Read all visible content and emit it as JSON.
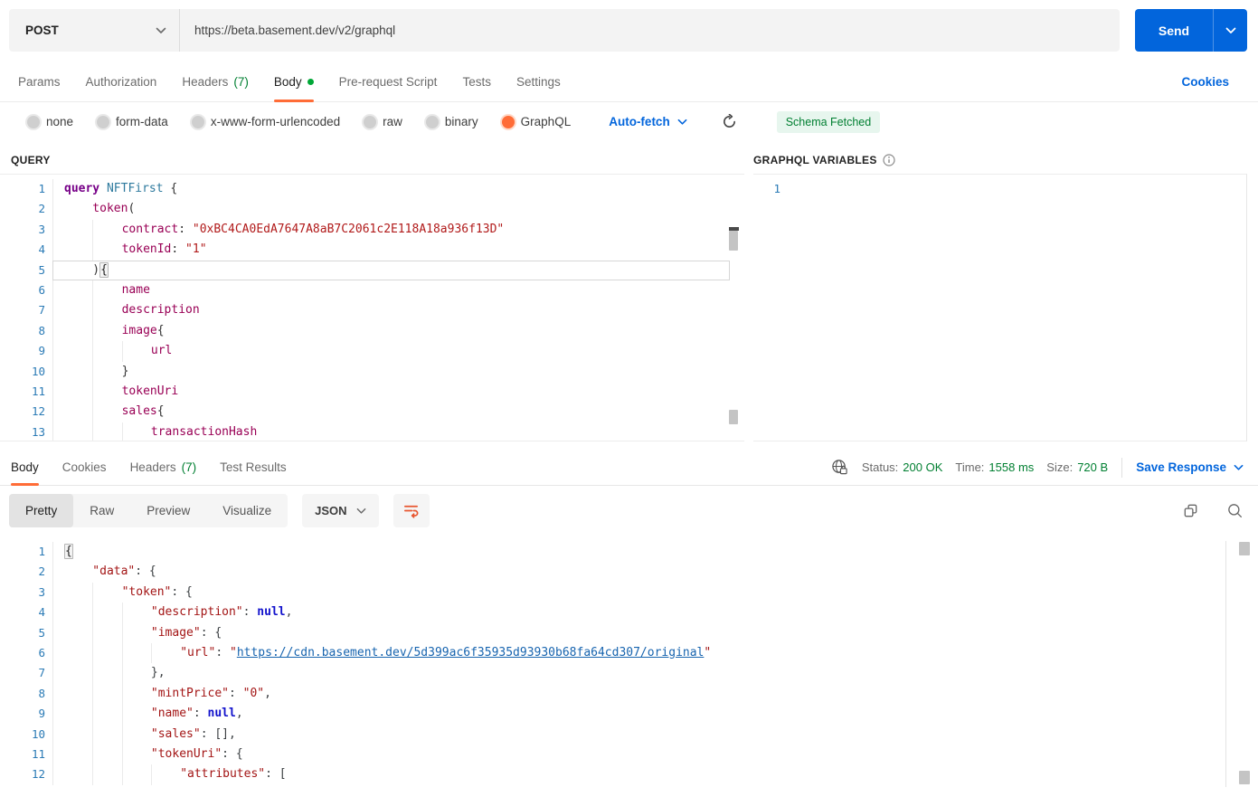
{
  "request": {
    "method": "POST",
    "url": "https://beta.basement.dev/v2/graphql",
    "send_label": "Send"
  },
  "request_tabs": {
    "items": [
      {
        "label": "Params"
      },
      {
        "label": "Authorization"
      },
      {
        "label": "Headers",
        "count": "(7)"
      },
      {
        "label": "Body",
        "dot": true,
        "active": true
      },
      {
        "label": "Pre-request Script"
      },
      {
        "label": "Tests"
      },
      {
        "label": "Settings"
      }
    ],
    "cookies_link": "Cookies"
  },
  "body_modes": {
    "options": [
      {
        "label": "none"
      },
      {
        "label": "form-data"
      },
      {
        "label": "x-www-form-urlencoded"
      },
      {
        "label": "raw"
      },
      {
        "label": "binary"
      },
      {
        "label": "GraphQL",
        "selected": true
      }
    ],
    "autofetch_label": "Auto-fetch",
    "schema_badge": "Schema Fetched"
  },
  "query_panel": {
    "title": "QUERY",
    "lines": [
      {
        "n": 1,
        "i": 0,
        "t": [
          [
            "kw",
            "query"
          ],
          [
            "pl",
            " "
          ],
          [
            "op",
            "NFTFirst"
          ],
          [
            "pl",
            " {"
          ]
        ]
      },
      {
        "n": 2,
        "i": 1,
        "t": [
          [
            "prop",
            "token"
          ],
          [
            "pl",
            "("
          ]
        ]
      },
      {
        "n": 3,
        "i": 2,
        "t": [
          [
            "prop",
            "contract"
          ],
          [
            "pl",
            ": "
          ],
          [
            "str",
            "\"0xBC4CA0EdA7647A8aB7C2061c2E118A18a936f13D\""
          ]
        ]
      },
      {
        "n": 4,
        "i": 2,
        "t": [
          [
            "prop",
            "tokenId"
          ],
          [
            "pl",
            ": "
          ],
          [
            "str",
            "\"1\""
          ]
        ]
      },
      {
        "n": 5,
        "i": 1,
        "a": true,
        "t": [
          [
            "pl",
            ")"
          ],
          [
            "brk",
            "{"
          ]
        ]
      },
      {
        "n": 6,
        "i": 2,
        "t": [
          [
            "prop",
            "name"
          ]
        ]
      },
      {
        "n": 7,
        "i": 2,
        "t": [
          [
            "prop",
            "description"
          ]
        ]
      },
      {
        "n": 8,
        "i": 2,
        "t": [
          [
            "prop",
            "image"
          ],
          [
            "pl",
            "{"
          ]
        ]
      },
      {
        "n": 9,
        "i": 3,
        "t": [
          [
            "prop",
            "url"
          ]
        ]
      },
      {
        "n": 10,
        "i": 2,
        "t": [
          [
            "pl",
            "}"
          ]
        ]
      },
      {
        "n": 11,
        "i": 2,
        "t": [
          [
            "prop",
            "tokenUri"
          ]
        ]
      },
      {
        "n": 12,
        "i": 2,
        "t": [
          [
            "prop",
            "sales"
          ],
          [
            "pl",
            "{"
          ]
        ]
      },
      {
        "n": 13,
        "i": 3,
        "t": [
          [
            "prop",
            "transactionHash"
          ]
        ]
      }
    ]
  },
  "variables_panel": {
    "title": "GRAPHQL VARIABLES",
    "lines": [
      {
        "n": 1,
        "i": 0,
        "t": []
      }
    ]
  },
  "response": {
    "tabs": [
      {
        "label": "Body",
        "active": true
      },
      {
        "label": "Cookies"
      },
      {
        "label": "Headers",
        "count": "(7)"
      },
      {
        "label": "Test Results"
      }
    ],
    "status_items": [
      {
        "label": "Status:",
        "value": "200 OK"
      },
      {
        "label": "Time:",
        "value": "1558 ms"
      },
      {
        "label": "Size:",
        "value": "720 B"
      }
    ],
    "save_label": "Save Response",
    "view_tabs": [
      {
        "label": "Pretty",
        "active": true
      },
      {
        "label": "Raw"
      },
      {
        "label": "Preview"
      },
      {
        "label": "Visualize"
      }
    ],
    "format": "JSON",
    "lines": [
      {
        "n": 1,
        "i": 0,
        "t": [
          [
            "brk",
            "{"
          ]
        ]
      },
      {
        "n": 2,
        "i": 1,
        "t": [
          [
            "key",
            "\"data\""
          ],
          [
            "pn",
            ": {"
          ]
        ]
      },
      {
        "n": 3,
        "i": 2,
        "t": [
          [
            "key",
            "\"token\""
          ],
          [
            "pn",
            ": {"
          ]
        ]
      },
      {
        "n": 4,
        "i": 3,
        "t": [
          [
            "key",
            "\"description\""
          ],
          [
            "pn",
            ": "
          ],
          [
            "nul",
            "null"
          ],
          [
            "pn",
            ","
          ]
        ]
      },
      {
        "n": 5,
        "i": 3,
        "t": [
          [
            "key",
            "\"image\""
          ],
          [
            "pn",
            ": {"
          ]
        ]
      },
      {
        "n": 6,
        "i": 4,
        "t": [
          [
            "key",
            "\"url\""
          ],
          [
            "pn",
            ": "
          ],
          [
            "key",
            "\""
          ],
          [
            "link",
            "https://cdn.basement.dev/5d399ac6f35935d93930b68fa64cd307/original"
          ],
          [
            "key",
            "\""
          ]
        ]
      },
      {
        "n": 7,
        "i": 3,
        "t": [
          [
            "pn",
            "},"
          ]
        ]
      },
      {
        "n": 8,
        "i": 3,
        "t": [
          [
            "key",
            "\"mintPrice\""
          ],
          [
            "pn",
            ": "
          ],
          [
            "key",
            "\"0\""
          ],
          [
            "pn",
            ","
          ]
        ]
      },
      {
        "n": 9,
        "i": 3,
        "t": [
          [
            "key",
            "\"name\""
          ],
          [
            "pn",
            ": "
          ],
          [
            "nul",
            "null"
          ],
          [
            "pn",
            ","
          ]
        ]
      },
      {
        "n": 10,
        "i": 3,
        "t": [
          [
            "key",
            "\"sales\""
          ],
          [
            "pn",
            ": [],"
          ]
        ]
      },
      {
        "n": 11,
        "i": 3,
        "t": [
          [
            "key",
            "\"tokenUri\""
          ],
          [
            "pn",
            ": {"
          ]
        ]
      },
      {
        "n": 12,
        "i": 4,
        "t": [
          [
            "key",
            "\"attributes\""
          ],
          [
            "pn",
            ": ["
          ]
        ]
      }
    ]
  },
  "colors": {
    "accent_orange": "#FF6C37",
    "primary_blue": "#0265DC",
    "success_green": "#007F31"
  }
}
